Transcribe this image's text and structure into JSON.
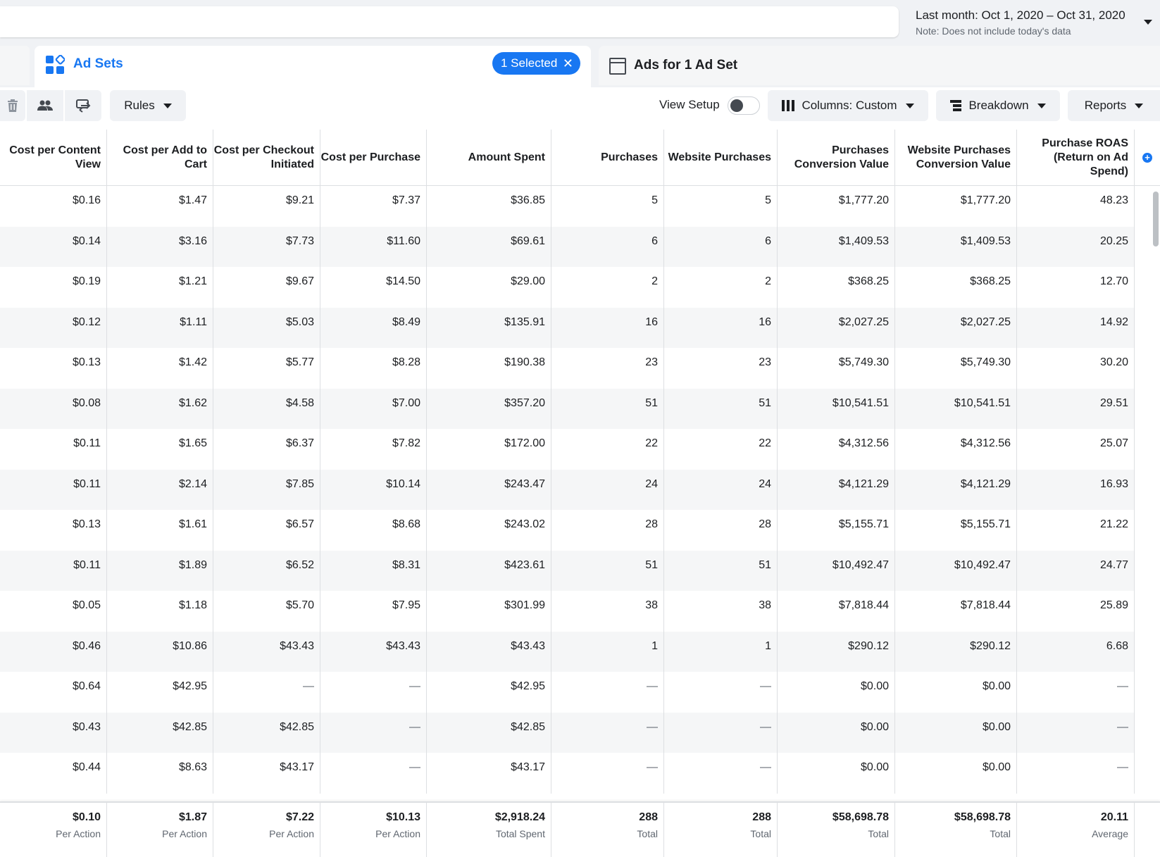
{
  "date_range": {
    "label": "Last month: Oct 1, 2020 – Oct 31, 2020",
    "note": "Note: Does not include today's data"
  },
  "tabs": {
    "adsets_label": "Ad Sets",
    "selected_label": "1 Selected",
    "ads_label": "Ads for 1 Ad Set"
  },
  "toolbar": {
    "rules_label": "Rules",
    "view_setup_label": "View Setup",
    "columns_label": "Columns: Custom",
    "breakdown_label": "Breakdown",
    "reports_label": "Reports"
  },
  "table": {
    "columns": [
      "Cost per Content View",
      "Cost per Add to Cart",
      "Cost per Checkout Initiated",
      "Cost per Purchase",
      "Amount Spent",
      "Purchases",
      "Website Purchases",
      "Purchases Conversion Value",
      "Website Purchases Conversion Value",
      "Purchase ROAS (Return on Ad Spend)"
    ],
    "rows": [
      [
        "$0.16",
        "$1.47",
        "$9.21",
        "$7.37",
        "$36.85",
        "5",
        "5",
        "$1,777.20",
        "$1,777.20",
        "48.23"
      ],
      [
        "$0.14",
        "$3.16",
        "$7.73",
        "$11.60",
        "$69.61",
        "6",
        "6",
        "$1,409.53",
        "$1,409.53",
        "20.25"
      ],
      [
        "$0.19",
        "$1.21",
        "$9.67",
        "$14.50",
        "$29.00",
        "2",
        "2",
        "$368.25",
        "$368.25",
        "12.70"
      ],
      [
        "$0.12",
        "$1.11",
        "$5.03",
        "$8.49",
        "$135.91",
        "16",
        "16",
        "$2,027.25",
        "$2,027.25",
        "14.92"
      ],
      [
        "$0.13",
        "$1.42",
        "$5.77",
        "$8.28",
        "$190.38",
        "23",
        "23",
        "$5,749.30",
        "$5,749.30",
        "30.20"
      ],
      [
        "$0.08",
        "$1.62",
        "$4.58",
        "$7.00",
        "$357.20",
        "51",
        "51",
        "$10,541.51",
        "$10,541.51",
        "29.51"
      ],
      [
        "$0.11",
        "$1.65",
        "$6.37",
        "$7.82",
        "$172.00",
        "22",
        "22",
        "$4,312.56",
        "$4,312.56",
        "25.07"
      ],
      [
        "$0.11",
        "$2.14",
        "$7.85",
        "$10.14",
        "$243.47",
        "24",
        "24",
        "$4,121.29",
        "$4,121.29",
        "16.93"
      ],
      [
        "$0.13",
        "$1.61",
        "$6.57",
        "$8.68",
        "$243.02",
        "28",
        "28",
        "$5,155.71",
        "$5,155.71",
        "21.22"
      ],
      [
        "$0.11",
        "$1.89",
        "$6.52",
        "$8.31",
        "$423.61",
        "51",
        "51",
        "$10,492.47",
        "$10,492.47",
        "24.77"
      ],
      [
        "$0.05",
        "$1.18",
        "$5.70",
        "$7.95",
        "$301.99",
        "38",
        "38",
        "$7,818.44",
        "$7,818.44",
        "25.89"
      ],
      [
        "$0.46",
        "$10.86",
        "$43.43",
        "$43.43",
        "$43.43",
        "1",
        "1",
        "$290.12",
        "$290.12",
        "6.68"
      ],
      [
        "$0.64",
        "$42.95",
        "—",
        "—",
        "$42.95",
        "—",
        "—",
        "$0.00",
        "$0.00",
        "—"
      ],
      [
        "$0.43",
        "$42.85",
        "$42.85",
        "—",
        "$42.85",
        "—",
        "—",
        "$0.00",
        "$0.00",
        "—"
      ],
      [
        "$0.44",
        "$8.63",
        "$43.17",
        "—",
        "$43.17",
        "—",
        "—",
        "$0.00",
        "$0.00",
        "—"
      ]
    ],
    "totals": [
      {
        "value": "$0.10",
        "label": "Per Action"
      },
      {
        "value": "$1.87",
        "label": "Per Action"
      },
      {
        "value": "$7.22",
        "label": "Per Action"
      },
      {
        "value": "$10.13",
        "label": "Per Action"
      },
      {
        "value": "$2,918.24",
        "label": "Total Spent"
      },
      {
        "value": "288",
        "label": "Total"
      },
      {
        "value": "288",
        "label": "Total"
      },
      {
        "value": "$58,698.78",
        "label": "Total"
      },
      {
        "value": "$58,698.78",
        "label": "Total"
      },
      {
        "value": "20.11",
        "label": "Average"
      }
    ]
  },
  "colors": {
    "accent": "#1877f2",
    "border": "#dddfe2",
    "row_alt": "#f5f6f7"
  }
}
